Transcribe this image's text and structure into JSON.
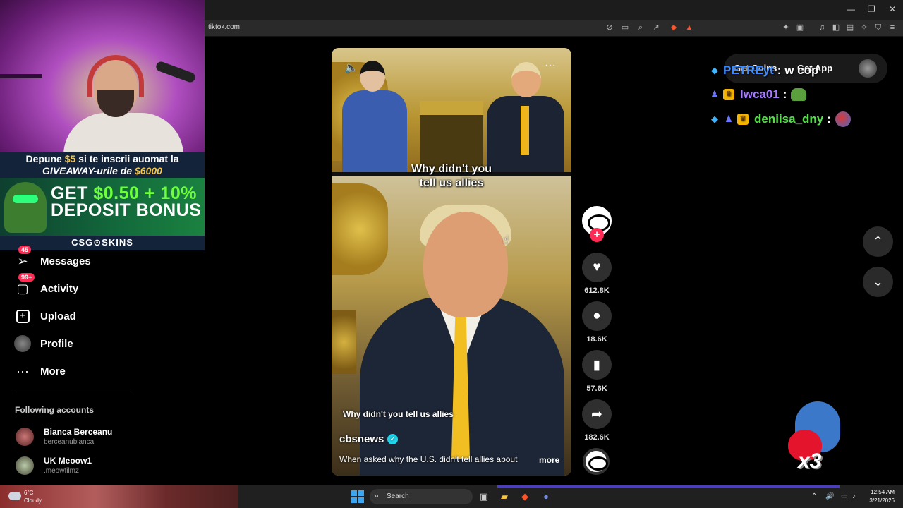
{
  "browser": {
    "url": "tiktok.com",
    "window_controls": {
      "minimize": "—",
      "maximize": "❐",
      "close": "✕"
    }
  },
  "promo": {
    "line1_a": "Depune",
    "line1_amount": "$5",
    "line1_b": "si te inscrii auomat la",
    "line2_a": "GIVEAWAY-urile de",
    "line2_amount": "$6000",
    "big_line1_a": "GET",
    "big_line1_amount": "$0.50 + 10%",
    "big_line2": "DEPOSIT BONUS",
    "brand": "CSG⊙SKINS"
  },
  "sidebar": {
    "items": [
      {
        "label": "Messages",
        "badge": "45",
        "icon": "paper-plane-icon"
      },
      {
        "label": "Activity",
        "badge": "99+",
        "icon": "inbox-icon"
      },
      {
        "label": "Upload",
        "icon": "plus-square-icon"
      },
      {
        "label": "Profile",
        "icon": "avatar"
      },
      {
        "label": "More",
        "icon": "more-dots-icon"
      }
    ],
    "following_title": "Following accounts",
    "following": [
      {
        "name": "Bianca Berceanu",
        "handle": "berceanubianca"
      },
      {
        "name": "UK Meoow1",
        "handle": ".meowfilmz"
      }
    ]
  },
  "video": {
    "overlay_caption_line1": "Why didn't you",
    "overlay_caption_line2": "tell us allies",
    "bottom_caption": "Why didn't you tell us allies",
    "author": "cbsnews",
    "description": "When asked why the U.S. didn't tell allies about",
    "more": "more"
  },
  "actions": {
    "likes": "612.8K",
    "comments": "18.6K",
    "saves": "57.6K",
    "shares": "182.6K"
  },
  "top_right": {
    "coins": "Get Coins",
    "app": "Get App"
  },
  "chat": [
    {
      "user": "PETREyt",
      "message": "w cop",
      "user_color": "#3d8bff"
    },
    {
      "user": "lwca01",
      "message": "",
      "user_color": "#a77bff"
    },
    {
      "user": "deniisa_dny",
      "message": "",
      "user_color": "#55e04a"
    }
  ],
  "gift": {
    "multiplier": "x3"
  },
  "taskbar": {
    "temperature": "6°C",
    "condition": "Cloudy",
    "search": "Search",
    "time": "12:54 AM",
    "date": "3/21/2026"
  }
}
